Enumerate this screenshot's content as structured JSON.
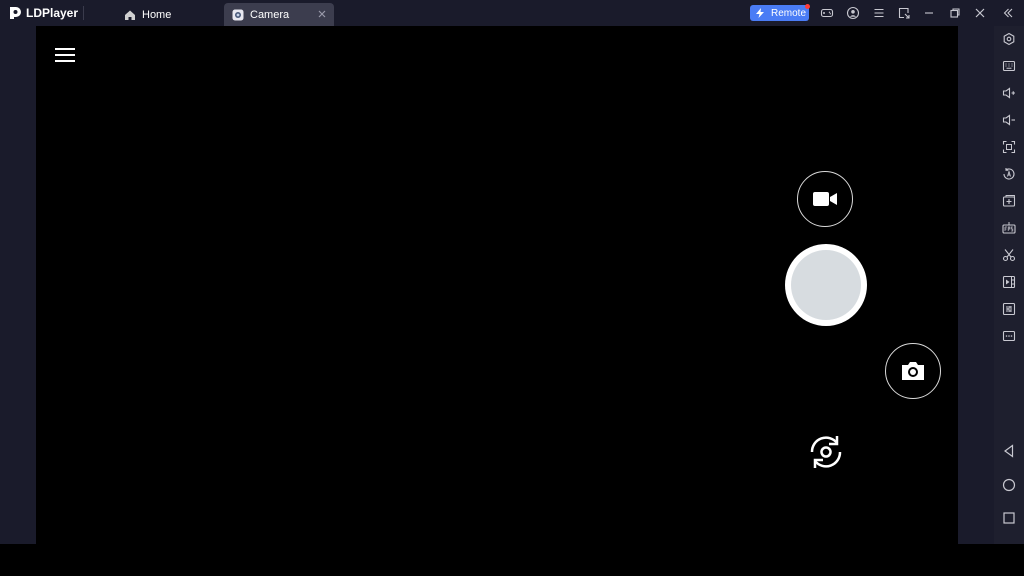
{
  "window": {
    "app_name": "LDPlayer",
    "tabs": [
      {
        "label": "Home",
        "icon": "home-icon"
      },
      {
        "label": "Camera",
        "icon": "camera-app-icon",
        "active": true
      }
    ],
    "remote_label": "Remote",
    "toolbar_icons": [
      "gamepad-icon",
      "account-icon",
      "menu-icon",
      "resize-icon",
      "minimize-icon",
      "restore-icon",
      "close-icon"
    ]
  },
  "sidebar": {
    "top_icons": [
      "collapse-icon",
      "settings-icon",
      "keyboard-mapping-icon",
      "volume-up-icon",
      "volume-down-icon",
      "fullscreen-icon",
      "rotate-icon",
      "install-apk-icon",
      "fps-icon",
      "scissors-icon",
      "video-record-icon",
      "operation-record-icon",
      "more-icon"
    ],
    "bottom_icons": [
      "back-icon",
      "home-circle-icon",
      "recent-apps-icon"
    ]
  },
  "camera": {
    "controls": [
      "hamburger-menu-icon",
      "video-mode-icon",
      "shutter-button",
      "photo-mode-icon",
      "switch-camera-icon"
    ]
  },
  "colors": {
    "titlebar_bg": "#1a1b2b",
    "active_tab_bg": "#3c3d4e",
    "accent": "#4a7cf5",
    "screen_bg": "#000000",
    "shutter_inner": "#d7dce0"
  }
}
